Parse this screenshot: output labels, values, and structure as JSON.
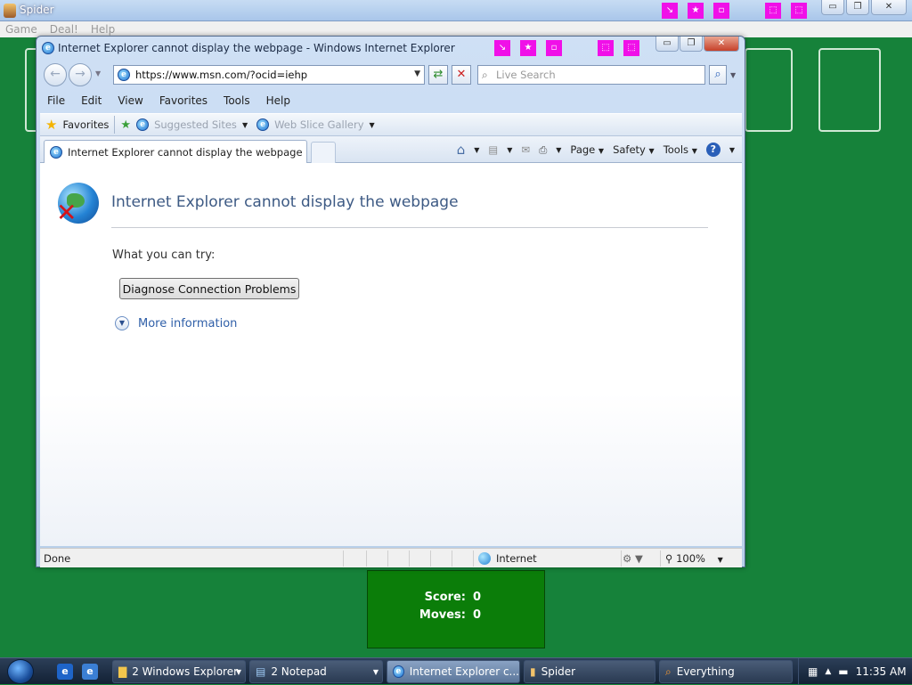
{
  "spider": {
    "title": "Spider",
    "menu": [
      "Game",
      "Deal!",
      "Help"
    ],
    "score_label": "Score:",
    "score_value": "0",
    "moves_label": "Moves:",
    "moves_value": "0",
    "window_buttons": {
      "minimize": "▭",
      "restore": "❐",
      "close": "✕"
    },
    "overlay_icons": [
      "↘",
      "★",
      "▫",
      "⬚",
      "⬚"
    ]
  },
  "ie": {
    "window_title": "Internet Explorer cannot display the webpage - Windows Internet Explorer",
    "overlay_icons": [
      "↘",
      "★",
      "▫",
      "⬚",
      "⬚"
    ],
    "window_buttons": {
      "minimize": "▭",
      "restore": "❐",
      "close": "✕"
    },
    "address": "https://www.msn.com/?ocid=iehp",
    "search_placeholder": "Live Search",
    "menu": [
      "File",
      "Edit",
      "View",
      "Favorites",
      "Tools",
      "Help"
    ],
    "favorites_label": "Favorites",
    "suggested_sites": "Suggested Sites",
    "web_slice_gallery": "Web Slice Gallery",
    "tab_title": "Internet Explorer cannot display the webpage",
    "commands": {
      "page": "Page",
      "safety": "Safety",
      "tools": "Tools",
      "help": "?"
    },
    "content": {
      "heading": "Internet Explorer cannot display the webpage",
      "try_text": "What you can try:",
      "diagnose_button": "Diagnose Connection Problems",
      "more_info": "More information"
    },
    "status": {
      "text": "Done",
      "zone": "Internet",
      "zoom": "100%"
    }
  },
  "taskbar": {
    "buttons": [
      {
        "label": "2 Windows Explorer"
      },
      {
        "label": "2 Notepad"
      },
      {
        "label": "Internet Explorer c..."
      },
      {
        "label": "Spider"
      },
      {
        "label": "Everything"
      }
    ],
    "clock": "11:35 AM"
  }
}
